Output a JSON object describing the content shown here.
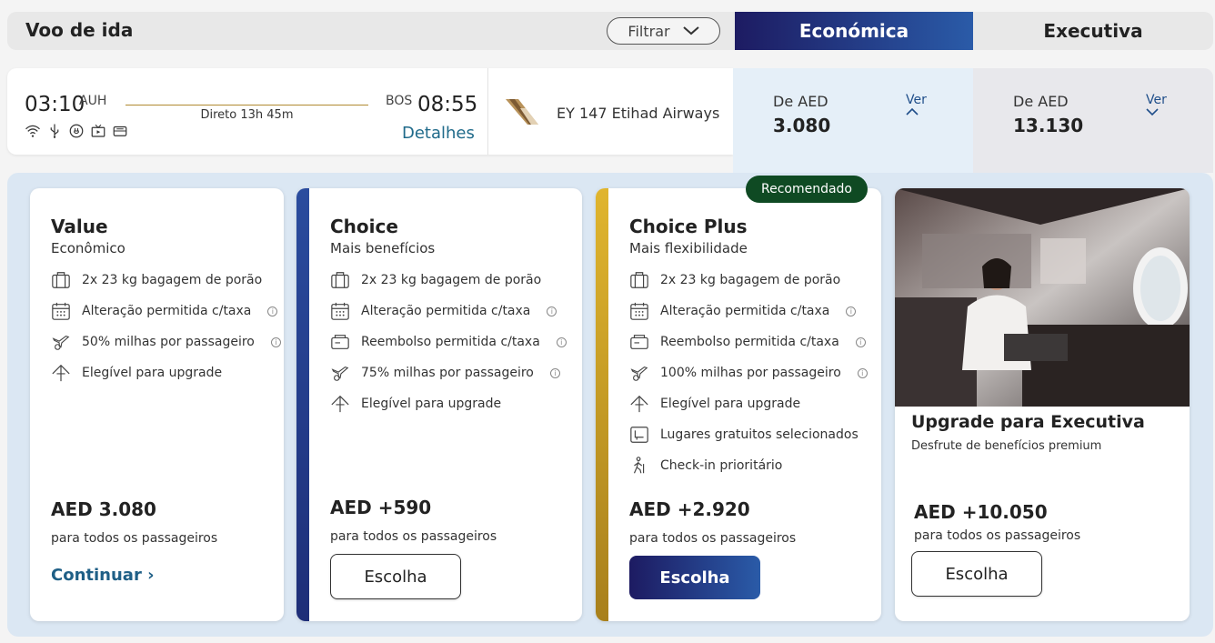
{
  "header": {
    "title": "Voo de ida",
    "filter_label": "Filtrar",
    "tab_economy": "Económica",
    "tab_business": "Executiva"
  },
  "flight": {
    "dep_time": "03:10",
    "dep_code": "AUH",
    "arr_code": "BOS",
    "arr_time": "08:55",
    "route_info": "Direto 13h 45m",
    "details_label": "Detalhes",
    "airline": "EY 147 Etihad Airways",
    "amenity_icons": [
      "wifi-icon",
      "usb-icon",
      "power-icon",
      "entertainment-icon",
      "meal-icon"
    ]
  },
  "prices": {
    "economy": {
      "from_label": "De AED",
      "value": "3.080",
      "view_label": "Ver",
      "chevron": "up"
    },
    "business": {
      "from_label": "De AED",
      "value": "13.130",
      "view_label": "Ver",
      "chevron": "down"
    }
  },
  "fares": [
    {
      "title": "Value",
      "subtitle": "Econômico",
      "features": [
        {
          "icon": "baggage-icon",
          "text": "2x 23 kg bagagem de porão",
          "info": false
        },
        {
          "icon": "calendar-icon",
          "text": "Alteração permitida c/taxa",
          "info": true
        },
        {
          "icon": "miles-icon",
          "text": "50% milhas por passageiro",
          "info": true
        },
        {
          "icon": "upgrade-icon",
          "text": "Elegível para upgrade",
          "info": false
        }
      ],
      "price": "AED 3.080",
      "note": "para todos os passageiros",
      "action": "Continuar"
    },
    {
      "title": "Choice",
      "subtitle": "Mais benefícios",
      "accent": "#2a4c9e",
      "features": [
        {
          "icon": "baggage-icon",
          "text": "2x 23 kg bagagem de porão",
          "info": false
        },
        {
          "icon": "calendar-icon",
          "text": "Alteração permitida c/taxa",
          "info": true
        },
        {
          "icon": "refund-icon",
          "text": "Reembolso permitida c/taxa",
          "info": true
        },
        {
          "icon": "miles-icon",
          "text": "75% milhas por passageiro",
          "info": true
        },
        {
          "icon": "upgrade-icon",
          "text": "Elegível para upgrade",
          "info": false
        }
      ],
      "price": "AED +590",
      "note": "para todos os passageiros",
      "action": "Escolha"
    },
    {
      "title": "Choice Plus",
      "subtitle": "Mais flexibilidade",
      "accent": "#c9a12a",
      "badge": "Recomendado",
      "features": [
        {
          "icon": "baggage-icon",
          "text": "2x 23 kg bagagem de porão",
          "info": false
        },
        {
          "icon": "calendar-icon",
          "text": "Alteração permitida c/taxa",
          "info": true
        },
        {
          "icon": "refund-icon",
          "text": "Reembolso permitida c/taxa",
          "info": true
        },
        {
          "icon": "miles-icon",
          "text": "100% milhas por passageiro",
          "info": true
        },
        {
          "icon": "upgrade-icon",
          "text": "Elegível para upgrade",
          "info": false
        },
        {
          "icon": "seat-icon",
          "text": "Lugares gratuitos selecionados",
          "info": false
        },
        {
          "icon": "priority-checkin-icon",
          "text": "Check-in prioritário",
          "info": false
        }
      ],
      "price": "AED +2.920",
      "note": "para todos os passageiros",
      "action": "Escolha"
    },
    {
      "title": "Upgrade para Executiva",
      "subtitle": "Desfrute de benefícios premium",
      "price": "AED +10.050",
      "note": "para todos os passageiros",
      "action": "Escolha"
    }
  ],
  "colors": {
    "brand_gradient_start": "#1d1b62",
    "brand_gradient_end": "#2a5ba8",
    "link": "#1f6a8a",
    "badge": "#0f4a23",
    "panel_bg": "#dbe7f3"
  }
}
